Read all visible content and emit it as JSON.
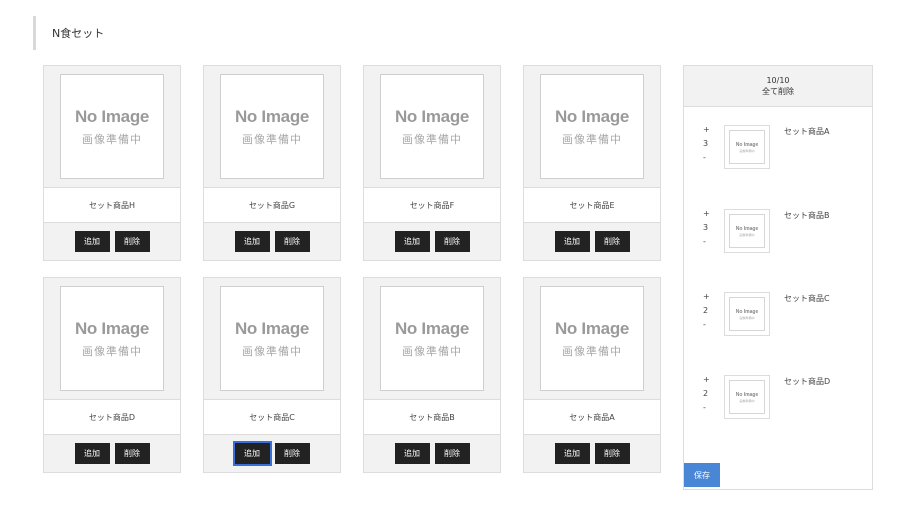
{
  "page": {
    "title": "N食セット"
  },
  "no_image": {
    "main": "No Image",
    "sub": "画像準備中"
  },
  "buttons": {
    "add": "追加",
    "delete": "削除"
  },
  "products": [
    {
      "name": "セット商品H"
    },
    {
      "name": "セット商品G"
    },
    {
      "name": "セット商品F"
    },
    {
      "name": "セット商品E"
    },
    {
      "name": "セット商品D"
    },
    {
      "name": "セット商品C"
    },
    {
      "name": "セット商品B"
    },
    {
      "name": "セット商品A"
    }
  ],
  "selection": {
    "count": "10/10",
    "clear_all": "全て削除",
    "plus": "+",
    "minus": "-",
    "items": [
      {
        "name": "セット商品A",
        "qty": "3"
      },
      {
        "name": "セット商品B",
        "qty": "3"
      },
      {
        "name": "セット商品C",
        "qty": "2"
      },
      {
        "name": "セット商品D",
        "qty": "2"
      }
    ],
    "save": "保存"
  },
  "colors": {
    "button_dark": "#222222",
    "save_blue": "#4a86d6",
    "focus_outline": "#3b6fd8"
  }
}
